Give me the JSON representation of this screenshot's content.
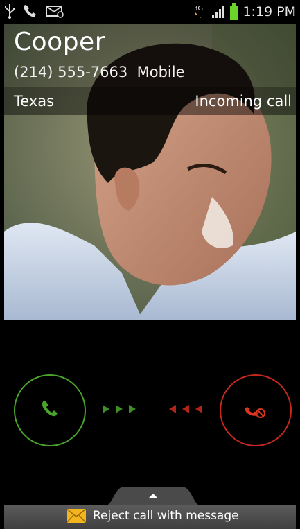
{
  "status_bar": {
    "time": "1:19 PM",
    "network": "3G",
    "icons": [
      "usb-icon",
      "missed-call-icon",
      "email-notification-icon",
      "data-3g-icon",
      "signal-icon",
      "battery-icon"
    ]
  },
  "caller": {
    "name": "Cooper",
    "number": "(214) 555-7663",
    "number_type": "Mobile",
    "location": "Texas",
    "call_state": "Incoming call"
  },
  "actions": {
    "answer_icon": "phone-answer-icon",
    "decline_icon": "phone-decline-icon",
    "answer_color": "#4aa32a",
    "decline_color": "#c6281d",
    "reject_message_label": "Reject call with message",
    "reject_message_icon": "envelope-icon"
  }
}
